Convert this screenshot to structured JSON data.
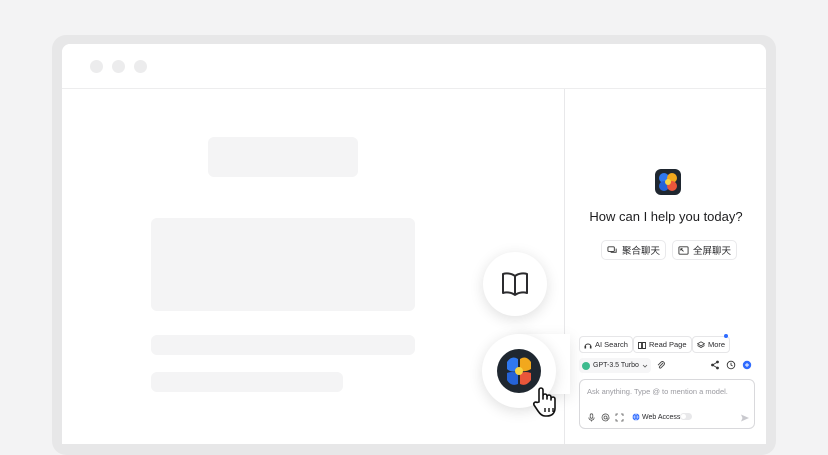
{
  "sidebar": {
    "greeting": "How can I help you today?",
    "quick_actions": [
      {
        "label": "聚合聊天",
        "icon": "multi-chat-icon"
      },
      {
        "label": "全屏聊天",
        "icon": "fullscreen-icon"
      }
    ],
    "tools": [
      {
        "label": "AI Search",
        "icon": "search-icon"
      },
      {
        "label": "Read Page",
        "icon": "book-icon"
      },
      {
        "label": "More",
        "icon": "layers-icon"
      }
    ],
    "model": {
      "label": "GPT-3.5 Turbo",
      "color": "#3dbb8e"
    },
    "input": {
      "placeholder": "Ask anything. Type @ to mention a model."
    },
    "web_access": {
      "label": "Web Access",
      "enabled": false
    }
  },
  "colors": {
    "accent": "#2f6bff",
    "logo_bg": "#1f2730"
  }
}
